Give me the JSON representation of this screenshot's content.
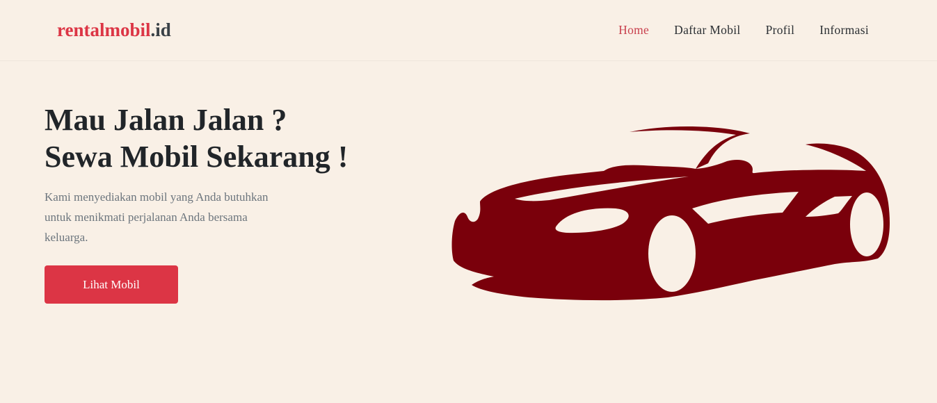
{
  "brand": {
    "name": "rentalmobil",
    "tld": ".id"
  },
  "nav": {
    "items": [
      {
        "label": "Home",
        "active": true
      },
      {
        "label": "Daftar Mobil",
        "active": false
      },
      {
        "label": "Profil",
        "active": false
      },
      {
        "label": "Informasi",
        "active": false
      }
    ]
  },
  "hero": {
    "title_line1": "Mau Jalan Jalan ?",
    "title_line2": "Sewa Mobil Sekarang !",
    "description": "Kami menyediakan mobil yang Anda butuhkan untuk menikmati perjalanan Anda bersama keluarga.",
    "button_label": "Lihat Mobil"
  },
  "illustration": {
    "icon": "car-silhouette-icon",
    "color": "#7a000b"
  },
  "colors": {
    "background": "#f9f0e6",
    "accent": "#dc3545",
    "text_dark": "#212529",
    "text_muted": "#6c757d"
  }
}
